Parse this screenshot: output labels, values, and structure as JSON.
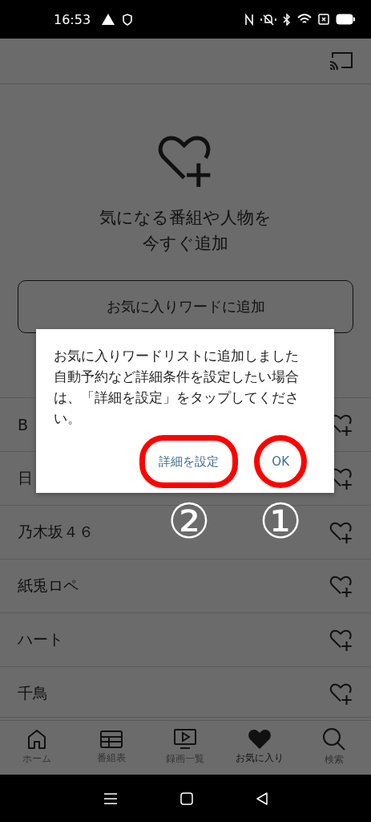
{
  "status_bar": {
    "time": "16:53"
  },
  "hero": {
    "title_lines": [
      "気になる番組や人物を",
      "今すぐ追加"
    ],
    "add_button": "お気に入りワードに追加"
  },
  "favorites": [
    {
      "name": "B"
    },
    {
      "name": "日"
    },
    {
      "name": "乃木坂４６"
    },
    {
      "name": "紙兎ロペ"
    },
    {
      "name": "ハート"
    },
    {
      "name": "千鳥"
    }
  ],
  "dialog": {
    "message": "お気に入りワードリストに追加しました自動予約など詳細条件を設定したい場合は、「詳細を設定」をタップしてください。",
    "buttons": [
      {
        "label": "詳細を設定",
        "marker": "②",
        "highlighted": true,
        "kind": "rounded"
      },
      {
        "label": "OK",
        "marker": "①",
        "highlighted": true,
        "kind": "circle"
      }
    ]
  },
  "bottom_nav": [
    {
      "label": "ホーム",
      "kind": "home",
      "selected": false
    },
    {
      "label": "番組表",
      "kind": "grid",
      "selected": false
    },
    {
      "label": "録画一覧",
      "kind": "tv",
      "selected": false
    },
    {
      "label": "お気に入り",
      "kind": "heart",
      "selected": true
    },
    {
      "label": "検索",
      "kind": "search",
      "selected": false
    }
  ]
}
